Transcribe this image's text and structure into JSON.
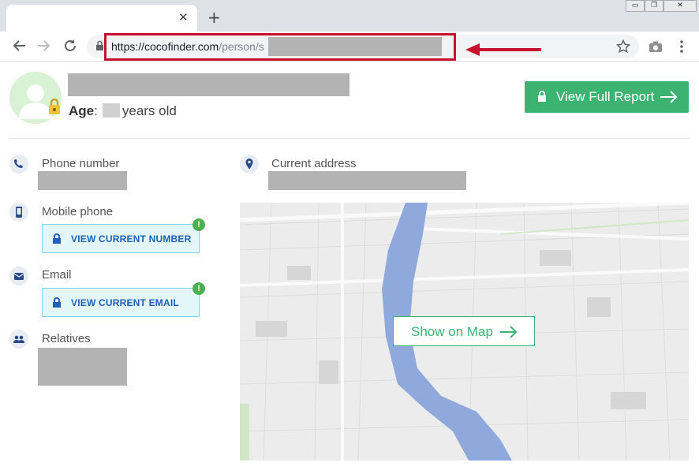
{
  "browser": {
    "new_tab_symbol": "+",
    "close_tab_symbol": "✕",
    "url_host": "https://cocofinder.com",
    "url_path": "/person/s",
    "window_controls": [
      "▭",
      "❐",
      "✕"
    ]
  },
  "profile": {
    "age_label": "Age",
    "age_suffix": "years old",
    "report_button": "View Full Report"
  },
  "contact": {
    "phone_label": "Phone number",
    "mobile_label": "Mobile phone",
    "mobile_button": "VIEW CURRENT NUMBER",
    "email_label": "Email",
    "email_button": "VIEW CURRENT EMAIL",
    "relatives_label": "Relatives",
    "badge": "!"
  },
  "address": {
    "label": "Current address"
  },
  "map": {
    "button": "Show on Map"
  },
  "colors": {
    "accent_green": "#3cb371",
    "highlight_red": "#c8102e",
    "reveal_blue": "#1f5fb4"
  }
}
